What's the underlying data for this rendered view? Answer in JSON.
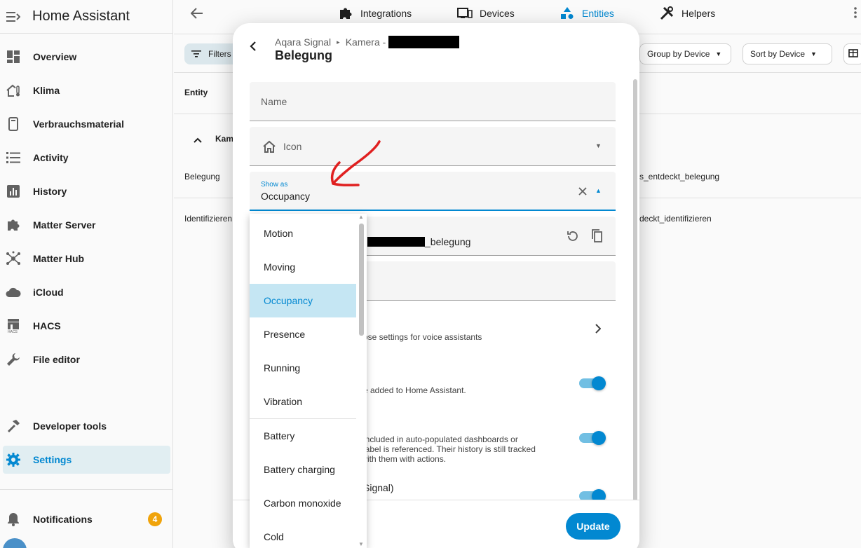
{
  "sidebar": {
    "title": "Home Assistant",
    "items": [
      {
        "label": "Overview",
        "icon": "overview-icon"
      },
      {
        "label": "Klima",
        "icon": "home-thermometer-icon"
      },
      {
        "label": "Verbrauchsmaterial",
        "icon": "phone-icon"
      },
      {
        "label": "Activity",
        "icon": "list-icon"
      },
      {
        "label": "History",
        "icon": "chart-icon"
      },
      {
        "label": "Matter Server",
        "icon": "puzzle-icon"
      },
      {
        "label": "Matter Hub",
        "icon": "hub-icon"
      },
      {
        "label": "iCloud",
        "icon": "cloud-icon"
      },
      {
        "label": "HACS",
        "icon": "hacs-icon"
      },
      {
        "label": "File editor",
        "icon": "wrench-icon"
      }
    ],
    "developer_tools": "Developer tools",
    "settings": "Settings",
    "notifications": "Notifications",
    "notifications_count": "4"
  },
  "topbar": {
    "tabs": [
      {
        "label": "Integrations"
      },
      {
        "label": "Devices"
      },
      {
        "label": "Entities"
      },
      {
        "label": "Helpers"
      }
    ]
  },
  "toolbar": {
    "filters": "Filters",
    "group_by": "Group by Device",
    "sort_by": "Sort by Device"
  },
  "table": {
    "header_entity": "Entity",
    "group_label": "Kam",
    "row1_name": "Belegung",
    "row1_id": "s_entdeckt_belegung",
    "row2_name": "Identifizieren",
    "row2_id": "deckt_identifizieren"
  },
  "dialog": {
    "breadcrumb_1": "Aqara Signal",
    "breadcrumb_2": "Kamera -",
    "title": "Belegung",
    "name_label": "Name",
    "icon_label": "Icon",
    "show_as_label": "Show as",
    "show_as_value": "Occupancy",
    "entity_id_suffix": "_belegung",
    "voice_text": "ose settings for voice assistants",
    "enabled_text": "e added to Home Assistant.",
    "visible_text_1": "included in auto-populated dashboards or",
    "visible_text_2": "label is referenced. Their history is still tracked",
    "visible_text_3": "vith them with actions.",
    "area_text": "Signal)",
    "update_button": "Update"
  },
  "dropdown": {
    "options": [
      "Motion",
      "Moving",
      "Occupancy",
      "Presence",
      "Running",
      "Vibration",
      "Battery",
      "Battery charging",
      "Carbon monoxide",
      "Cold"
    ],
    "selected": "Occupancy"
  },
  "colors": {
    "accent": "#0288d1",
    "selected_bg": "#c5e6f3",
    "badge": "#f0a30a",
    "annotation_arrow": "#e02020"
  }
}
